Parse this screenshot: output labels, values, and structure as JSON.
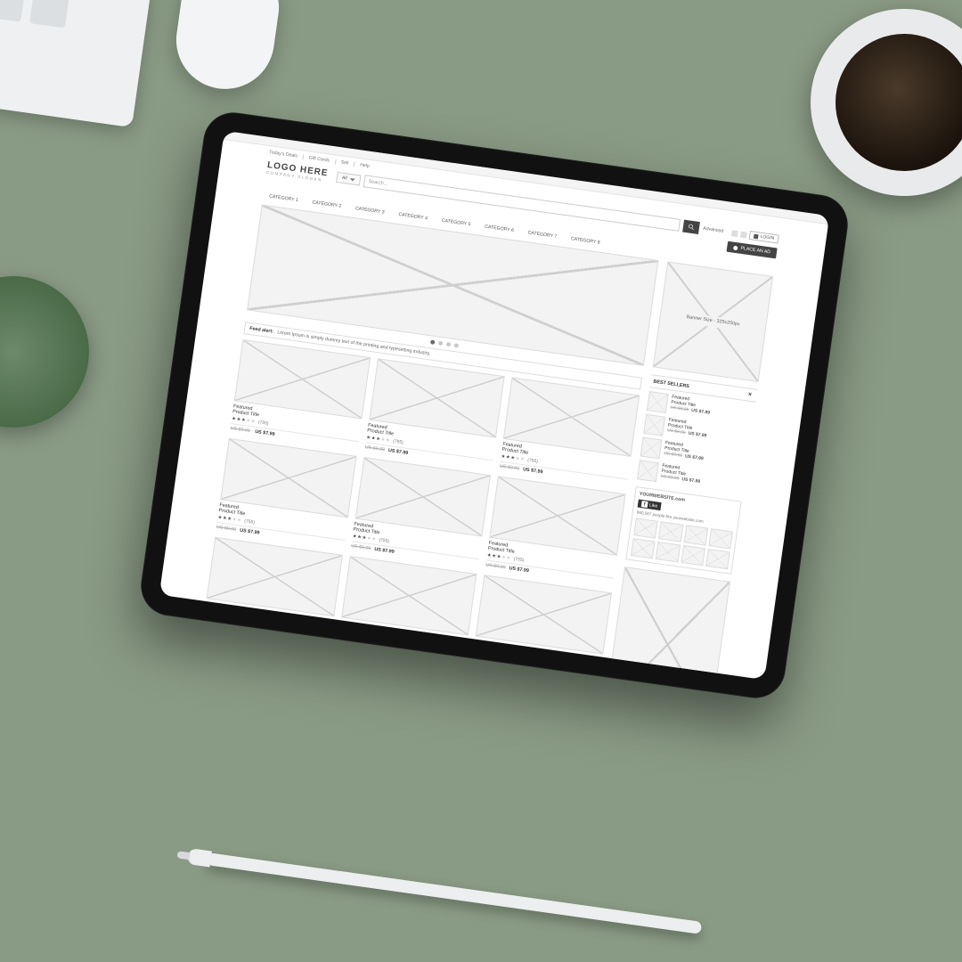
{
  "util_nav": [
    "Today's Deals",
    "Gift Cards",
    "Sell",
    "Help"
  ],
  "logo": {
    "title": "LOGO HERE",
    "tagline": "COMPANY SLOGAN"
  },
  "search": {
    "filter": "All",
    "placeholder": "Search...",
    "advanced": "Advanced"
  },
  "header": {
    "login": "LOGIN",
    "place_ad": "PLACE AN AD"
  },
  "categories": [
    "CATEGORY 1",
    "CATEGORY 2",
    "CATEGORY 3",
    "CATEGORY 4",
    "CATEGORY 5",
    "CATEGORY 6",
    "CATEGORY 7",
    "CATEGORY 8"
  ],
  "feed": {
    "label": "Feed alert:",
    "text": "Lorem Ipsum is simply dummy text of the printing and typesetting industry."
  },
  "product": {
    "line1": "Featured",
    "line2": "Product Title",
    "reviews": "(755)",
    "old_price": "US $9.99",
    "new_price": "US $7.99"
  },
  "sidebar": {
    "banner_text": "Banner Size - 325x250px",
    "best_sellers_title": "BEST SELLERS",
    "fb_site": "YOURWEBSITE.com",
    "fb_like": "Like",
    "fb_caption": "960,567 people like yourwebsite.com"
  }
}
